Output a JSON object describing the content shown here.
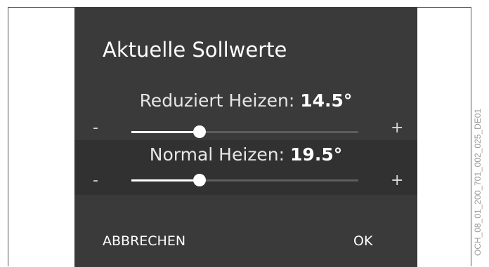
{
  "dialog": {
    "title": "Aktuelle Sollwerte",
    "rows": [
      {
        "label": "Reduziert Heizen:",
        "value": "14.5°",
        "minus": "-",
        "plus": "+",
        "slider_fraction": 0.3,
        "highlighted": false
      },
      {
        "label": "Normal Heizen:",
        "value": "19.5°",
        "minus": "-",
        "plus": "+",
        "slider_fraction": 0.3,
        "highlighted": true
      }
    ],
    "cancel_label": "ABBRECHEN",
    "ok_label": "OK"
  },
  "side_code": "OCH_08_01_200_701_002_025_DE01",
  "colors": {
    "dialog_bg": "#3a3a3a",
    "highlight_row_bg": "#313131",
    "track_bg": "#5d5d5d",
    "track_fill": "#ffffff"
  }
}
